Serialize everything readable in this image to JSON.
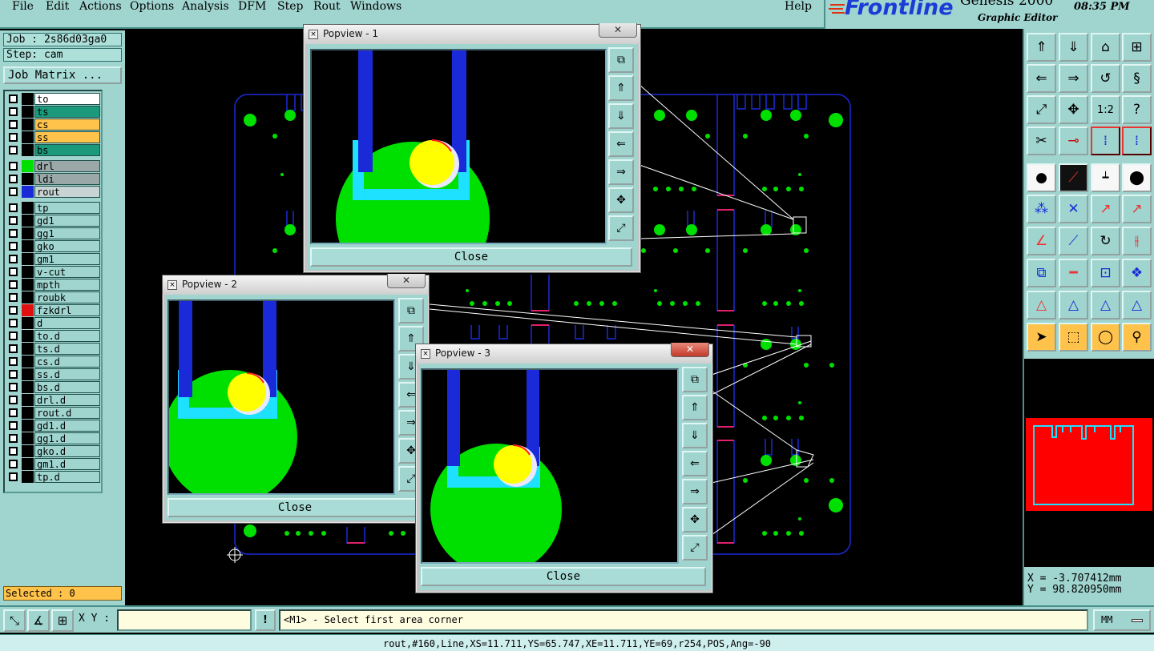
{
  "menu": {
    "items": [
      "File",
      "Edit",
      "Actions",
      "Options",
      "Analysis",
      "DFM",
      "Step",
      "Rout",
      "Windows"
    ],
    "help": "Help"
  },
  "brand": {
    "logo": "Frontline",
    "product": "Genesis 2000",
    "subtitle": "Graphic Editor",
    "time": "08:35 PM"
  },
  "left": {
    "job": "Job : 2s86d03ga0",
    "step": "Step: cam",
    "job_matrix": "Job Matrix ...",
    "selected": "Selected : 0",
    "layers": [
      {
        "name": "to",
        "color": "#ffffff",
        "swatch": "#000000"
      },
      {
        "name": "ts",
        "color": "#1a9a7a",
        "swatch": "#000000"
      },
      {
        "name": "cs",
        "color": "#ffc24a",
        "swatch": "#000000"
      },
      {
        "name": "ss",
        "color": "#ffc24a",
        "swatch": "#000000"
      },
      {
        "name": "bs",
        "color": "#1a9a7a",
        "swatch": "#000000"
      },
      {
        "name": "drl",
        "color": "#9aa8a8",
        "swatch": "#00e000"
      },
      {
        "name": "ldi",
        "color": "#9aa8a8",
        "swatch": "#000000"
      },
      {
        "name": "rout",
        "color": "#c8d4d4",
        "swatch": "#1a2ad8"
      },
      {
        "name": "tp",
        "color": "#9fd4cf",
        "swatch": "#000000"
      },
      {
        "name": "gd1",
        "color": "#9fd4cf",
        "swatch": "#000000"
      },
      {
        "name": "gg1",
        "color": "#9fd4cf",
        "swatch": "#000000"
      },
      {
        "name": "gko",
        "color": "#9fd4cf",
        "swatch": "#000000"
      },
      {
        "name": "gm1",
        "color": "#9fd4cf",
        "swatch": "#000000"
      },
      {
        "name": "v-cut",
        "color": "#9fd4cf",
        "swatch": "#000000"
      },
      {
        "name": "mpth",
        "color": "#9fd4cf",
        "swatch": "#000000"
      },
      {
        "name": "roubk",
        "color": "#9fd4cf",
        "swatch": "#000000"
      },
      {
        "name": "fzkdrl",
        "color": "#9fd4cf",
        "swatch": "#e01010"
      },
      {
        "name": "d",
        "color": "#9fd4cf",
        "swatch": "#000000"
      },
      {
        "name": "to.d",
        "color": "#9fd4cf",
        "swatch": "#000000"
      },
      {
        "name": "ts.d",
        "color": "#9fd4cf",
        "swatch": "#000000"
      },
      {
        "name": "cs.d",
        "color": "#9fd4cf",
        "swatch": "#000000"
      },
      {
        "name": "ss.d",
        "color": "#9fd4cf",
        "swatch": "#000000"
      },
      {
        "name": "bs.d",
        "color": "#9fd4cf",
        "swatch": "#000000"
      },
      {
        "name": "drl.d",
        "color": "#9fd4cf",
        "swatch": "#000000"
      },
      {
        "name": "rout.d",
        "color": "#9fd4cf",
        "swatch": "#000000"
      },
      {
        "name": "gd1.d",
        "color": "#9fd4cf",
        "swatch": "#000000"
      },
      {
        "name": "gg1.d",
        "color": "#9fd4cf",
        "swatch": "#000000"
      },
      {
        "name": "gko.d",
        "color": "#9fd4cf",
        "swatch": "#000000"
      },
      {
        "name": "gm1.d",
        "color": "#9fd4cf",
        "swatch": "#000000"
      },
      {
        "name": "tp.d",
        "color": "#9fd4cf",
        "swatch": "#000000"
      }
    ]
  },
  "popups": [
    {
      "title": "Popview - 1",
      "close_label": "Close"
    },
    {
      "title": "Popview - 2",
      "close_label": "Close"
    },
    {
      "title": "Popview - 3",
      "close_label": "Close"
    }
  ],
  "coords": {
    "x": "X = -3.707412mm",
    "y": "Y = 98.820950mm"
  },
  "bottom": {
    "xy_label": "X Y :",
    "xy_value": "",
    "prompt": "<M1> - Select first area corner",
    "units": "MM"
  },
  "status": "rout,#160,Line,XS=11.711,YS=65.747,XE=11.711,YE=69,r254,POS,Ang=-90",
  "colors": {
    "panel": "#9fd4cf",
    "rout": "#1a2ad8",
    "drill": "#00e000",
    "highlight": "#ffc24a",
    "pad_yellow": "#ffff00",
    "pad_cyan": "#1ee0ff"
  }
}
